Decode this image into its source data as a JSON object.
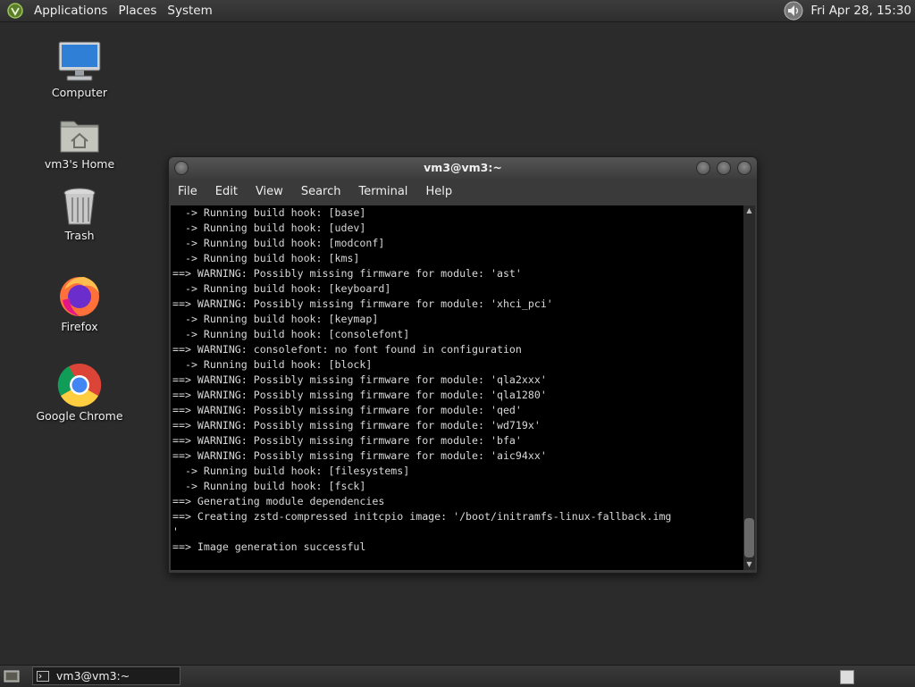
{
  "top_panel": {
    "menus": [
      "Applications",
      "Places",
      "System"
    ],
    "clock": "Fri Apr 28, 15:30"
  },
  "desktop_icons": [
    {
      "label": "Computer",
      "icon": "computer-icon"
    },
    {
      "label": "vm3's Home",
      "icon": "home-folder-icon"
    },
    {
      "label": "Trash",
      "icon": "trash-icon"
    },
    {
      "label": "Firefox",
      "icon": "firefox-icon"
    },
    {
      "label": "Google Chrome",
      "icon": "chrome-icon"
    }
  ],
  "terminal": {
    "title": "vm3@vm3:~",
    "menu": [
      "File",
      "Edit",
      "View",
      "Search",
      "Terminal",
      "Help"
    ],
    "lines": [
      "  -> Running build hook: [base]",
      "  -> Running build hook: [udev]",
      "  -> Running build hook: [modconf]",
      "  -> Running build hook: [kms]",
      "==> WARNING: Possibly missing firmware for module: 'ast'",
      "  -> Running build hook: [keyboard]",
      "==> WARNING: Possibly missing firmware for module: 'xhci_pci'",
      "  -> Running build hook: [keymap]",
      "  -> Running build hook: [consolefont]",
      "==> WARNING: consolefont: no font found in configuration",
      "  -> Running build hook: [block]",
      "==> WARNING: Possibly missing firmware for module: 'qla2xxx'",
      "==> WARNING: Possibly missing firmware for module: 'qla1280'",
      "==> WARNING: Possibly missing firmware for module: 'qed'",
      "==> WARNING: Possibly missing firmware for module: 'wd719x'",
      "==> WARNING: Possibly missing firmware for module: 'bfa'",
      "==> WARNING: Possibly missing firmware for module: 'aic94xx'",
      "  -> Running build hook: [filesystems]",
      "  -> Running build hook: [fsck]",
      "==> Generating module dependencies",
      "==> Creating zstd-compressed initcpio image: '/boot/initramfs-linux-fallback.img",
      "'",
      "==> Image generation successful"
    ]
  },
  "taskbar": {
    "task_label": "vm3@vm3:~"
  }
}
